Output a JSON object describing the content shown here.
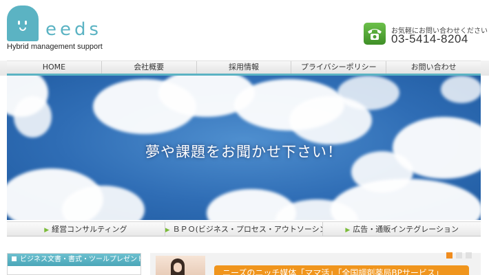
{
  "header": {
    "logo_word": "eeds",
    "logo_subtitle": "Hybrid management support",
    "phone_note": "お気軽にお問い合わせください",
    "phone_number": "03-5414-8204",
    "phone_icon": "telephone-icon"
  },
  "nav": {
    "items": [
      {
        "label": "HOME"
      },
      {
        "label": "会社概要"
      },
      {
        "label": "採用情報"
      },
      {
        "label": "プライバシーポリシー"
      },
      {
        "label": "お問い合わせ"
      }
    ]
  },
  "hero": {
    "headline": "夢や課題をお聞かせ下さい！"
  },
  "subnav": {
    "items": [
      {
        "label": "経営コンサルティング"
      },
      {
        "label": "ＢＰＯ(ビジネス・プロセス・アウトソーシング)"
      },
      {
        "label": "広告・通販インテグレーション"
      }
    ]
  },
  "sidebar": {
    "heading": "ビジネス文書・書式・ツールプレゼント"
  },
  "news": {
    "banner_text": "ニーズのニッチ媒体「ママ活」「全国調剤薬局BPサービス」"
  },
  "colors": {
    "brand": "#5bb3c3",
    "accent": "#f08c1e",
    "subnav_arrow": "#7bbb3a"
  }
}
